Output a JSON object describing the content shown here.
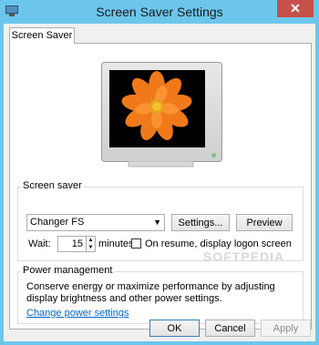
{
  "window": {
    "title": "Screen Saver Settings",
    "close_label": "✕"
  },
  "tabs": [
    {
      "label": "Screen Saver"
    }
  ],
  "screen_saver": {
    "group_label": "Screen saver",
    "selected": "Changer FS",
    "settings_label": "Settings...",
    "preview_label": "Preview",
    "wait_label": "Wait:",
    "wait_value": "15",
    "minutes_label": "minutes",
    "logon_label": "On resume, display logon screen"
  },
  "power": {
    "group_label": "Power management",
    "description": "Conserve energy or maximize performance by adjusting display brightness and other power settings.",
    "link_label": "Change power settings"
  },
  "footer": {
    "ok_label": "OK",
    "cancel_label": "Cancel",
    "apply_label": "Apply"
  },
  "watermark": "SOFTPEDIA"
}
